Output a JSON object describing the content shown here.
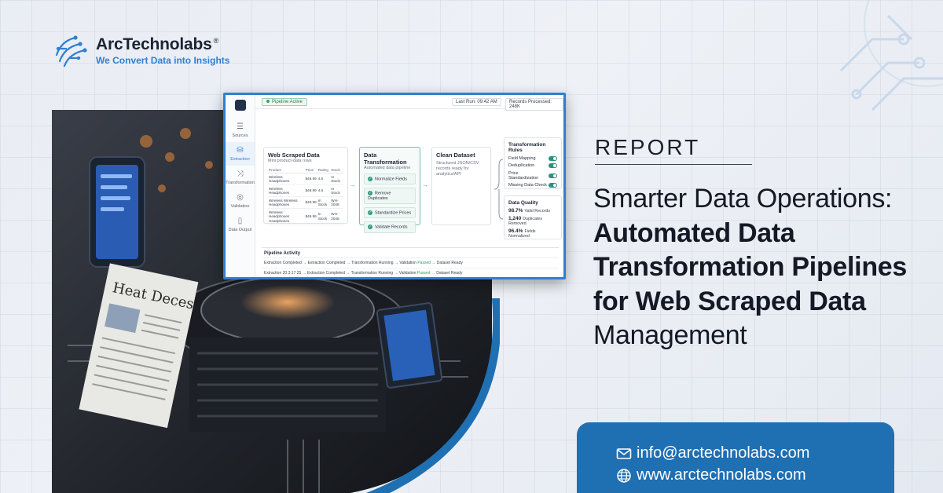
{
  "brand": {
    "name": "ArcTechnolabs",
    "mark": "®",
    "tagline": "We Convert Data into Insights"
  },
  "dashboard": {
    "status": "Pipeline Active",
    "last_run": "Last Run: 09:42 AM",
    "records": "Records Processed: 248K",
    "nav": [
      {
        "label": "Sources",
        "icon": "sliders-icon"
      },
      {
        "label": "Extraction",
        "icon": "database-icon"
      },
      {
        "label": "Transformation",
        "icon": "shuffle-icon"
      },
      {
        "label": "Validation",
        "icon": "check-circle-icon"
      },
      {
        "label": "Data Output",
        "icon": "file-icon"
      }
    ],
    "scraped": {
      "title": "Web Scraped Data",
      "subtitle": "Mini product-data rows",
      "headers": [
        "Product",
        "Price",
        "Rating",
        "Stock"
      ],
      "rows": [
        [
          "Wireless Headphones",
          "$49.99",
          "4.6",
          "In Stock"
        ],
        [
          "Wireless Headphones",
          "$49.99",
          "4.6",
          "In Stock"
        ],
        [
          "Wireless Wireless Headphones",
          "$49.99",
          "In Stock",
          "WH-2048"
        ],
        [
          "Wireless Headphones Headphones",
          "$49.99",
          "In Stock",
          "WH-2048"
        ]
      ]
    },
    "transform": {
      "title": "Data Transformation",
      "subtitle": "Automated data pipeline",
      "steps": [
        "Normalize Fields",
        "Remove Duplicates",
        "Standardize Prices",
        "Validate Records"
      ]
    },
    "clean": {
      "title": "Clean Dataset",
      "desc": "Structured JSON/CSV records ready for analytics/API"
    },
    "rules": {
      "title": "Transformation Rules",
      "items": [
        "Field Mapping",
        "Deduplication",
        "Price Standardization",
        "Missing Data Check"
      ]
    },
    "quality": {
      "title": "Data Quality",
      "items": [
        {
          "value": "98.7%",
          "label": "Valid Records"
        },
        {
          "value": "1,240",
          "label": "Duplicates Removed"
        },
        {
          "value": "96.4%",
          "label": "Fields Normalized"
        }
      ]
    },
    "activity": {
      "title": "Pipeline Activity",
      "rows": [
        {
          "a": "Extraction Completed",
          "b": "Extraction Completed",
          "c": "Transformation Running",
          "d": "Validation",
          "e": "Passed",
          "f": "Dataset Ready"
        },
        {
          "a": "Extraction 20:3:17:25",
          "b": "Extraction Completed",
          "c": "Transformation Running",
          "d": "Validation",
          "e": "Passed",
          "f": "Dataset Ready"
        }
      ]
    }
  },
  "hero": {
    "eyebrow": "REPORT",
    "headline_pre": "Smarter Data Operations: ",
    "headline_strong": "Automated Data Transformation Pipelines for Web Scraped Data",
    "headline_post": " Management"
  },
  "contact": {
    "email": "info@arctechnolabs.com",
    "website": "www.arctechnolabs.com"
  },
  "colors": {
    "accent": "#2f7fd1",
    "contact_bg": "#1f6fb3",
    "text": "#141925"
  }
}
